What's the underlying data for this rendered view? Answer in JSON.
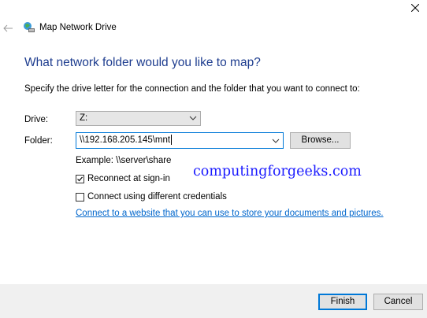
{
  "window": {
    "title": "Map Network Drive"
  },
  "heading": "What network folder would you like to map?",
  "instruction": "Specify the drive letter for the connection and the folder that you want to connect to:",
  "drive": {
    "label": "Drive:",
    "value": "Z:"
  },
  "folder": {
    "label": "Folder:",
    "value": "\\\\192.168.205.145\\mnt",
    "browse_label": "Browse..."
  },
  "example": "Example: \\\\server\\share",
  "options": {
    "reconnect_label": "Reconnect at sign-in",
    "reconnect_checked": true,
    "credentials_label": "Connect using different credentials",
    "credentials_checked": false
  },
  "link": "Connect to a website that you can use to store your documents and pictures.",
  "watermark": "computingforgeeks.com",
  "buttons": {
    "finish": "Finish",
    "cancel": "Cancel"
  },
  "icons": {
    "close": "close-icon",
    "back": "back-arrow-icon",
    "app": "network-drive-icon",
    "chevron": "chevron-down-icon",
    "check": "checkmark-icon"
  }
}
